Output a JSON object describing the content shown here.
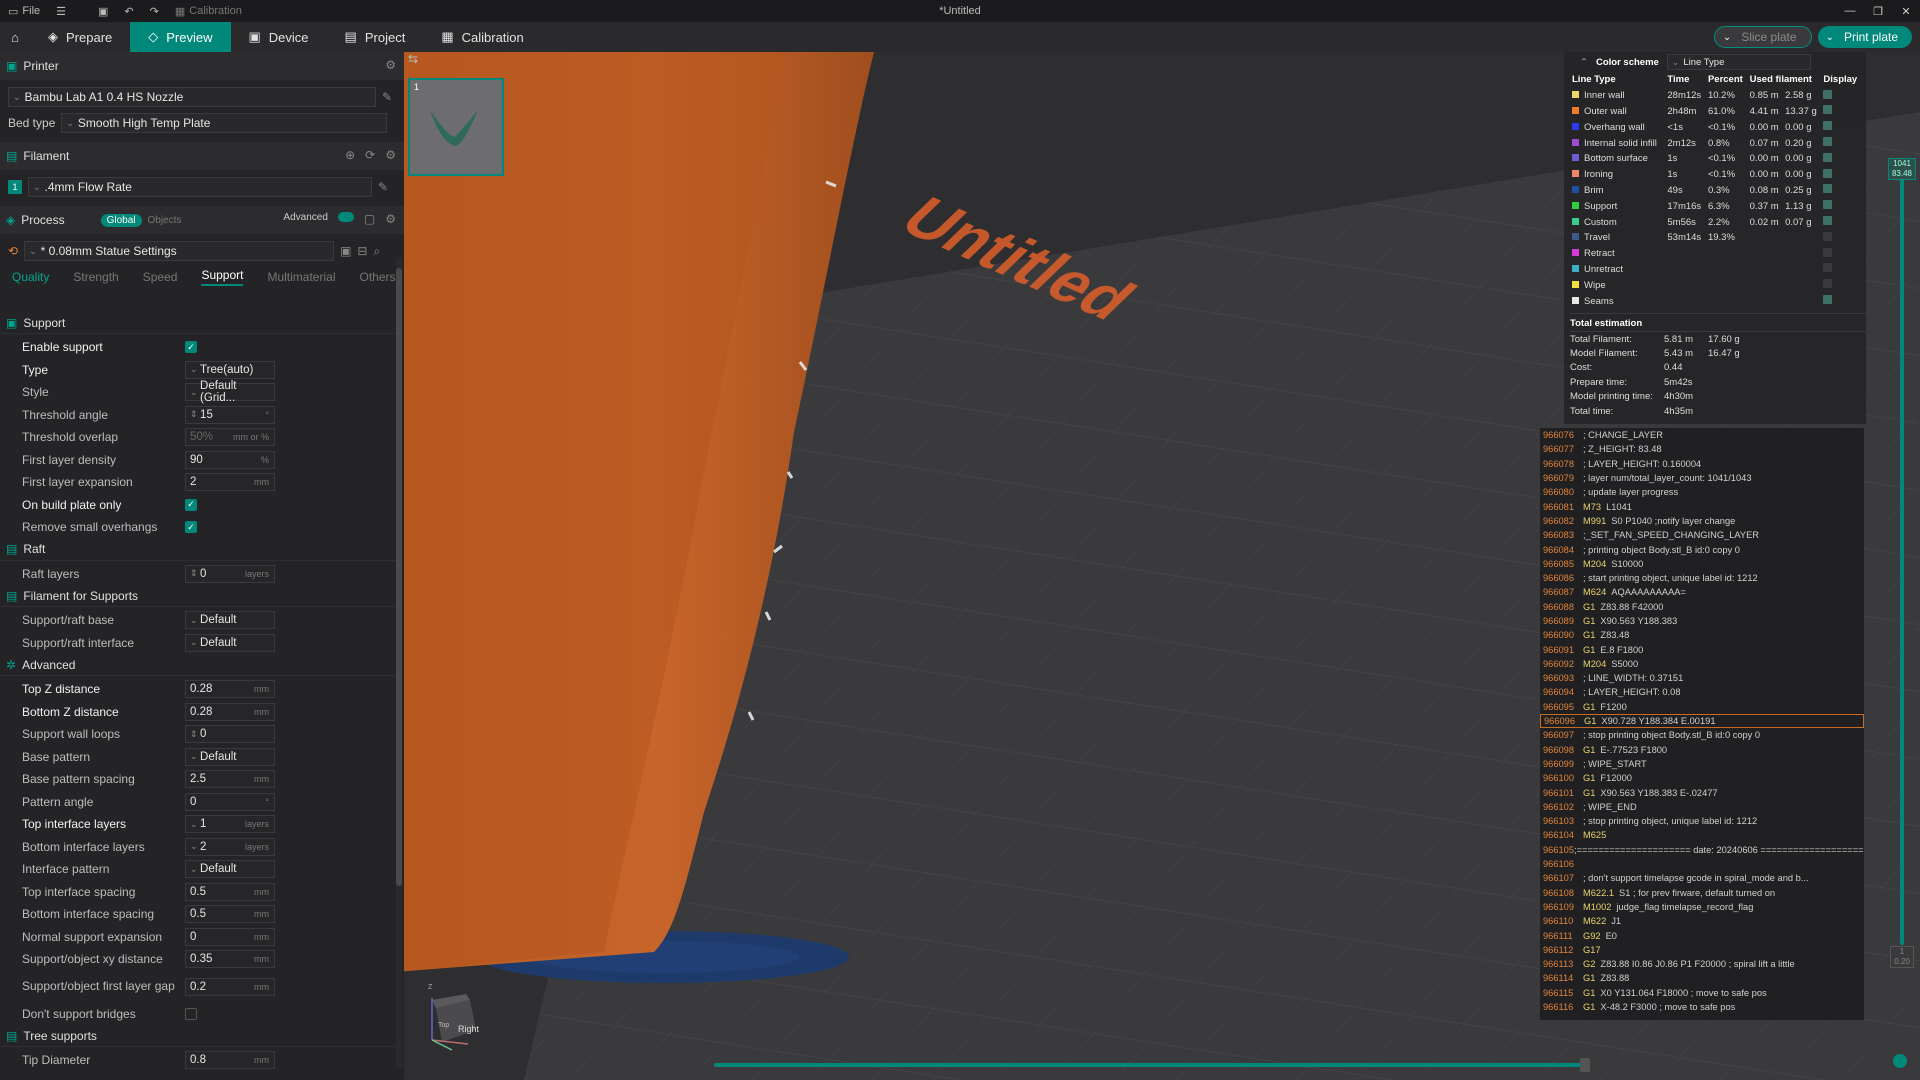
{
  "titlebar": {
    "file": "File",
    "title": "*Untitled",
    "calibration_tab": "Calibration"
  },
  "tabs": {
    "prepare": "Prepare",
    "preview": "Preview",
    "device": "Device",
    "project": "Project",
    "calibration": "Calibration"
  },
  "actions": {
    "slice": "Slice plate",
    "print": "Print plate"
  },
  "printer": {
    "header": "Printer",
    "name": "Bambu Lab A1 0.4 HS Nozzle",
    "bed_label": "Bed type",
    "bed": "Smooth High Temp Plate"
  },
  "filament": {
    "header": "Filament",
    "index": "1",
    "name": ".4mm Flow Rate"
  },
  "process": {
    "header": "Process",
    "global": "Global",
    "objects": "Objects",
    "advanced": "Advanced",
    "preset": "* 0.08mm Statue Settings"
  },
  "subtabs": [
    "Quality",
    "Strength",
    "Speed",
    "Support",
    "Multimaterial",
    "Others"
  ],
  "groups": {
    "support": "Support",
    "raft": "Raft",
    "filament_supports": "Filament for Supports",
    "advanced": "Advanced",
    "tree": "Tree supports"
  },
  "settings": {
    "enable_support": "Enable support",
    "type_label": "Type",
    "type_value": "Tree(auto)",
    "style_label": "Style",
    "style_value": "Default (Grid...",
    "threshold_angle_label": "Threshold angle",
    "threshold_angle_value": "15",
    "threshold_angle_unit": "°",
    "threshold_overlap_label": "Threshold overlap",
    "threshold_overlap_value": "50%",
    "threshold_overlap_unit": "mm or %",
    "first_layer_density_label": "First layer density",
    "first_layer_density_value": "90",
    "first_layer_density_unit": "%",
    "first_layer_expansion_label": "First layer expansion",
    "first_layer_expansion_value": "2",
    "first_layer_expansion_unit": "mm",
    "on_build_plate_label": "On build plate only",
    "remove_small_label": "Remove small overhangs",
    "raft_layers_label": "Raft layers",
    "raft_layers_value": "0",
    "raft_layers_unit": "layers",
    "raft_base_label": "Support/raft base",
    "raft_base_value": "Default",
    "raft_interface_label": "Support/raft interface",
    "raft_interface_value": "Default",
    "top_z_label": "Top Z distance",
    "top_z_value": "0.28",
    "top_z_unit": "mm",
    "bottom_z_label": "Bottom Z distance",
    "bottom_z_value": "0.28",
    "bottom_z_unit": "mm",
    "wall_loops_label": "Support wall loops",
    "wall_loops_value": "0",
    "base_pattern_label": "Base pattern",
    "base_pattern_value": "Default",
    "base_spacing_label": "Base pattern spacing",
    "base_spacing_value": "2.5",
    "base_spacing_unit": "mm",
    "pattern_angle_label": "Pattern angle",
    "pattern_angle_value": "0",
    "pattern_angle_unit": "°",
    "top_if_layers_label": "Top interface layers",
    "top_if_layers_value": "1",
    "top_if_layers_unit": "layers",
    "bottom_if_layers_label": "Bottom interface layers",
    "bottom_if_layers_value": "2",
    "bottom_if_layers_unit": "layers",
    "if_pattern_label": "Interface pattern",
    "if_pattern_value": "Default",
    "top_if_spacing_label": "Top interface spacing",
    "top_if_spacing_value": "0.5",
    "top_if_spacing_unit": "mm",
    "bottom_if_spacing_label": "Bottom interface spacing",
    "bottom_if_spacing_value": "0.5",
    "bottom_if_spacing_unit": "mm",
    "normal_exp_label": "Normal support expansion",
    "normal_exp_value": "0",
    "normal_exp_unit": "mm",
    "xy_dist_label": "Support/object xy distance",
    "xy_dist_value": "0.35",
    "xy_dist_unit": "mm",
    "first_gap_label": "Support/object first layer gap",
    "first_gap_value": "0.2",
    "first_gap_unit": "mm",
    "bridges_label": "Don't support bridges",
    "tip_label": "Tip Diameter",
    "tip_value": "0.8",
    "tip_unit": "mm"
  },
  "viewport": {
    "plate_number": "1",
    "plate_label": "Untitled",
    "cube_right": "Right",
    "cube_top": "Top",
    "axis_z": "Z",
    "layer_top": "1041",
    "layer_z": "83.48",
    "layer_bottom": "1",
    "layer_bottom_z": "0.20"
  },
  "legend": {
    "color_scheme_label": "Color scheme",
    "color_scheme_value": "Line Type",
    "headers": [
      "Line Type",
      "Time",
      "Percent",
      "Used filament",
      "Display"
    ],
    "rows": [
      {
        "name": "Inner wall",
        "color": "#f0d56a",
        "time": "28m12s",
        "pct": "10.2%",
        "len": "0.85 m",
        "wt": "2.58 g",
        "on": true
      },
      {
        "name": "Outer wall",
        "color": "#f07c2a",
        "time": "2h48m",
        "pct": "61.0%",
        "len": "4.41 m",
        "wt": "13.37 g",
        "on": true
      },
      {
        "name": "Overhang wall",
        "color": "#2b3cf0",
        "time": "<1s",
        "pct": "<0.1%",
        "len": "0.00 m",
        "wt": "0.00 g",
        "on": true
      },
      {
        "name": "Internal solid infill",
        "color": "#a14bd0",
        "time": "2m12s",
        "pct": "0.8%",
        "len": "0.07 m",
        "wt": "0.20 g",
        "on": true
      },
      {
        "name": "Bottom surface",
        "color": "#6f5bd6",
        "time": "1s",
        "pct": "<0.1%",
        "len": "0.00 m",
        "wt": "0.00 g",
        "on": true
      },
      {
        "name": "Ironing",
        "color": "#f0866a",
        "time": "1s",
        "pct": "<0.1%",
        "len": "0.00 m",
        "wt": "0.00 g",
        "on": true
      },
      {
        "name": "Brim",
        "color": "#1f4fa0",
        "time": "49s",
        "pct": "0.3%",
        "len": "0.08 m",
        "wt": "0.25 g",
        "on": true
      },
      {
        "name": "Support",
        "color": "#2fcf3f",
        "time": "17m16s",
        "pct": "6.3%",
        "len": "0.37 m",
        "wt": "1.13 g",
        "on": true
      },
      {
        "name": "Custom",
        "color": "#3acb8e",
        "time": "5m56s",
        "pct": "2.2%",
        "len": "0.02 m",
        "wt": "0.07 g",
        "on": true
      },
      {
        "name": "Travel",
        "color": "#3a5a8c",
        "time": "53m14s",
        "pct": "19.3%",
        "len": "",
        "wt": "",
        "on": false
      },
      {
        "name": "Retract",
        "color": "#d63bd6",
        "time": "",
        "pct": "",
        "len": "",
        "wt": "",
        "on": false
      },
      {
        "name": "Unretract",
        "color": "#3ab0c8",
        "time": "",
        "pct": "",
        "len": "",
        "wt": "",
        "on": false
      },
      {
        "name": "Wipe",
        "color": "#f0e13a",
        "time": "",
        "pct": "",
        "len": "",
        "wt": "",
        "on": false
      },
      {
        "name": "Seams",
        "color": "#e8e8e8",
        "time": "",
        "pct": "",
        "len": "",
        "wt": "",
        "on": true
      }
    ],
    "total_header": "Total estimation",
    "totals": [
      {
        "k": "Total Filament:",
        "v1": "5.81 m",
        "v2": "17.60 g"
      },
      {
        "k": "Model Filament:",
        "v1": "5.43 m",
        "v2": "16.47 g"
      },
      {
        "k": "Cost:",
        "v1": "0.44",
        "v2": ""
      },
      {
        "k": "Prepare time:",
        "v1": "5m42s",
        "v2": ""
      },
      {
        "k": "Model printing time:",
        "v1": "4h30m",
        "v2": ""
      },
      {
        "k": "Total time:",
        "v1": "4h35m",
        "v2": ""
      }
    ]
  },
  "gcode": [
    {
      "n": "966076",
      "c": "",
      "t": "; CHANGE_LAYER"
    },
    {
      "n": "966077",
      "c": "",
      "t": "; Z_HEIGHT: 83.48"
    },
    {
      "n": "966078",
      "c": "",
      "t": "; LAYER_HEIGHT: 0.160004"
    },
    {
      "n": "966079",
      "c": "",
      "t": "; layer num/total_layer_count: 1041/1043"
    },
    {
      "n": "966080",
      "c": "",
      "t": "; update layer progress"
    },
    {
      "n": "966081",
      "c": "M73",
      "t": "L1041"
    },
    {
      "n": "966082",
      "c": "M991",
      "t": "S0 P1040 ;notify layer change"
    },
    {
      "n": "966083",
      "c": "",
      "t": ";_SET_FAN_SPEED_CHANGING_LAYER"
    },
    {
      "n": "966084",
      "c": "",
      "t": "; printing object Body.stl_B id:0 copy 0"
    },
    {
      "n": "966085",
      "c": "M204",
      "t": "S10000"
    },
    {
      "n": "966086",
      "c": "",
      "t": "; start printing object, unique label id: 1212"
    },
    {
      "n": "966087",
      "c": "M624",
      "t": "AQAAAAAAAAA="
    },
    {
      "n": "966088",
      "c": "G1",
      "t": "Z83.88 F42000"
    },
    {
      "n": "966089",
      "c": "G1",
      "t": "X90.563 Y188.383"
    },
    {
      "n": "966090",
      "c": "G1",
      "t": "Z83.48"
    },
    {
      "n": "966091",
      "c": "G1",
      "t": "E.8 F1800"
    },
    {
      "n": "966092",
      "c": "M204",
      "t": "S5000"
    },
    {
      "n": "966093",
      "c": "",
      "t": "; LINE_WIDTH: 0.37151"
    },
    {
      "n": "966094",
      "c": "",
      "t": "; LAYER_HEIGHT: 0.08"
    },
    {
      "n": "966095",
      "c": "G1",
      "t": "F1200"
    },
    {
      "n": "966096",
      "c": "G1",
      "t": "X90.728 Y188.384 E.00191"
    },
    {
      "n": "966097",
      "c": "",
      "t": "; stop printing object Body.stl_B id:0 copy 0"
    },
    {
      "n": "966098",
      "c": "G1",
      "t": "E-.77523 F1800"
    },
    {
      "n": "966099",
      "c": "",
      "t": "; WIPE_START"
    },
    {
      "n": "966100",
      "c": "G1",
      "t": "F12000"
    },
    {
      "n": "966101",
      "c": "G1",
      "t": "X90.563 Y188.383 E-.02477"
    },
    {
      "n": "966102",
      "c": "",
      "t": "; WIPE_END"
    },
    {
      "n": "966103",
      "c": "",
      "t": "; stop printing object, unique label id: 1212"
    },
    {
      "n": "966104",
      "c": "M625",
      "t": ""
    },
    {
      "n": "966105",
      "c": "",
      "t": ";===================== date: 20240606 ====================="
    },
    {
      "n": "966106",
      "c": "",
      "t": ""
    },
    {
      "n": "966107",
      "c": "",
      "t": "; don't support timelapse gcode in spiral_mode and b..."
    },
    {
      "n": "966108",
      "c": "M622.1",
      "t": "S1 ; for prev firware, default turned on"
    },
    {
      "n": "966109",
      "c": "M1002",
      "t": "judge_flag timelapse_record_flag"
    },
    {
      "n": "966110",
      "c": "M622",
      "t": "J1"
    },
    {
      "n": "966111",
      "c": "G92",
      "t": "E0"
    },
    {
      "n": "966112",
      "c": "G17",
      "t": ""
    },
    {
      "n": "966113",
      "c": "G2",
      "t": "Z83.88 I0.86 J0.86 P1 F20000 ; spiral lift a little"
    },
    {
      "n": "966114",
      "c": "G1",
      "t": "Z83.88"
    },
    {
      "n": "966115",
      "c": "G1",
      "t": "X0 Y131.064 F18000 ; move to safe pos"
    },
    {
      "n": "966116",
      "c": "G1",
      "t": "X-48.2 F3000 ; move to safe pos"
    }
  ],
  "gcode_highlight": 20
}
